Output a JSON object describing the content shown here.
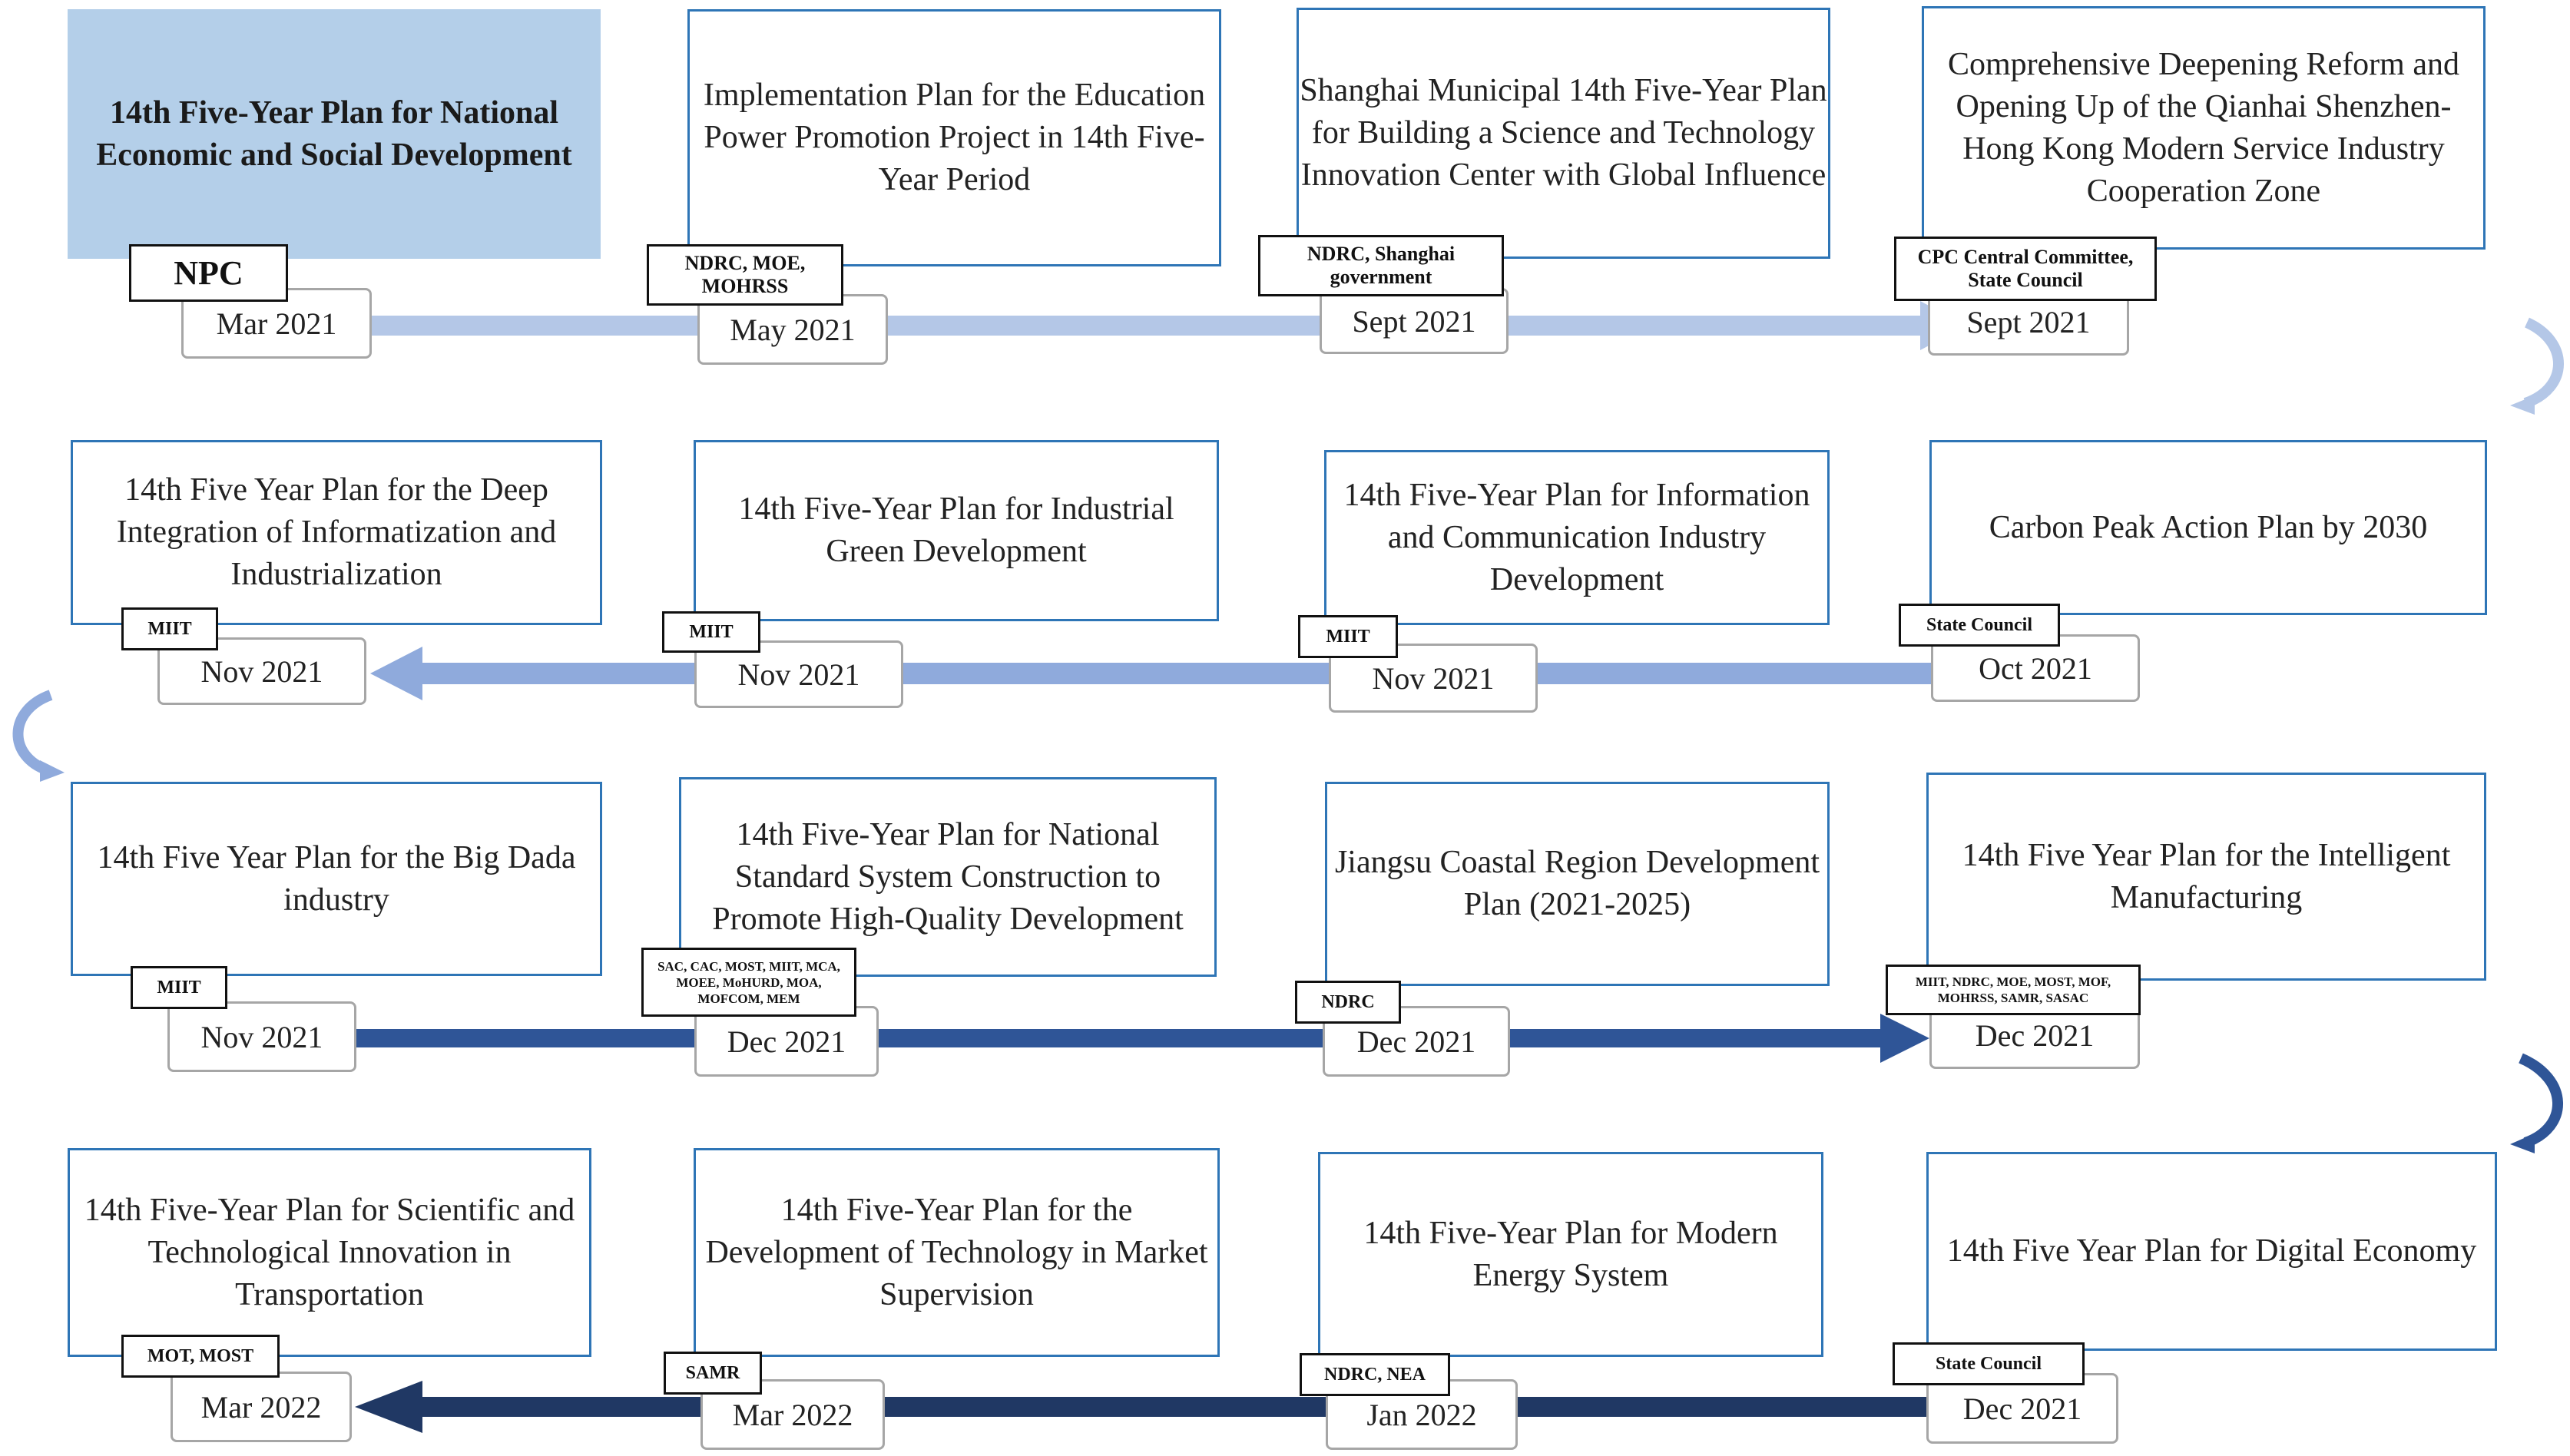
{
  "colors": {
    "row1": "#b4c7e7",
    "row2": "#8faadc",
    "row3": "#2f5597",
    "row4": "#203864",
    "card_border": "#2e75b6",
    "highlight_fill": "#b4cfe9"
  },
  "rows": [
    {
      "direction": "right",
      "items": [
        {
          "title": "14th Five-Year Plan for National Economic and Social Development",
          "authority": "NPC",
          "date": "Mar 2021"
        },
        {
          "title": "Implementation Plan for the Education Power Promotion Project in 14th Five-Year Period",
          "authority": "NDRC, MOE, MOHRSS",
          "date": "May 2021"
        },
        {
          "title": "Shanghai Municipal 14th Five-Year Plan for Building a Science and Technology Innovation Center with Global Influence",
          "authority": "NDRC, Shanghai government",
          "date": "Sept 2021"
        },
        {
          "title": "Comprehensive Deepening Reform and Opening Up of the Qianhai Shenzhen-Hong Kong Modern Service Industry Cooperation Zone",
          "authority": "CPC Central Committee, State Council",
          "date": "Sept 2021"
        }
      ]
    },
    {
      "direction": "left",
      "items": [
        {
          "title": "14th Five Year Plan for the Deep Integration of Informatization and Industrialization",
          "authority": "MIIT",
          "date": "Nov 2021"
        },
        {
          "title": "14th Five-Year Plan for Industrial Green Development",
          "authority": "MIIT",
          "date": "Nov 2021"
        },
        {
          "title": "14th Five-Year Plan for Information and Communication Industry Development",
          "authority": "MIIT",
          "date": "Nov 2021"
        },
        {
          "title": "Carbon Peak Action Plan by 2030",
          "authority": "State Council",
          "date": "Oct 2021"
        }
      ]
    },
    {
      "direction": "right",
      "items": [
        {
          "title": "14th Five Year Plan for the Big Dada industry",
          "authority": "MIIT",
          "date": "Nov 2021"
        },
        {
          "title": "14th Five-Year Plan for National Standard System Construction to Promote High-Quality Development",
          "authority": "SAC, CAC, MOST, MIIT, MCA, MOEE, MoHURD, MOA, MOFCOM, MEM",
          "date": "Dec 2021"
        },
        {
          "title": "Jiangsu Coastal Region Development Plan (2021-2025)",
          "authority": "NDRC",
          "date": "Dec 2021"
        },
        {
          "title": "14th Five Year Plan for the Intelligent Manufacturing",
          "authority": "MIIT, NDRC, MOE, MOST, MOF, MOHRSS, SAMR, SASAC",
          "date": "Dec 2021"
        }
      ]
    },
    {
      "direction": "left",
      "items": [
        {
          "title": "14th Five-Year Plan for Scientific and Technological Innovation in Transportation",
          "authority": "MOT, MOST",
          "date": "Mar 2022"
        },
        {
          "title": "14th Five-Year Plan for the Development of Technology in Market Supervision",
          "authority": "SAMR",
          "date": "Mar 2022"
        },
        {
          "title": "14th Five-Year Plan for Modern Energy System",
          "authority": "NDRC, NEA",
          "date": "Jan 2022"
        },
        {
          "title": "14th Five Year Plan for Digital Economy",
          "authority": "State Council",
          "date": "Dec 2021"
        }
      ]
    }
  ]
}
